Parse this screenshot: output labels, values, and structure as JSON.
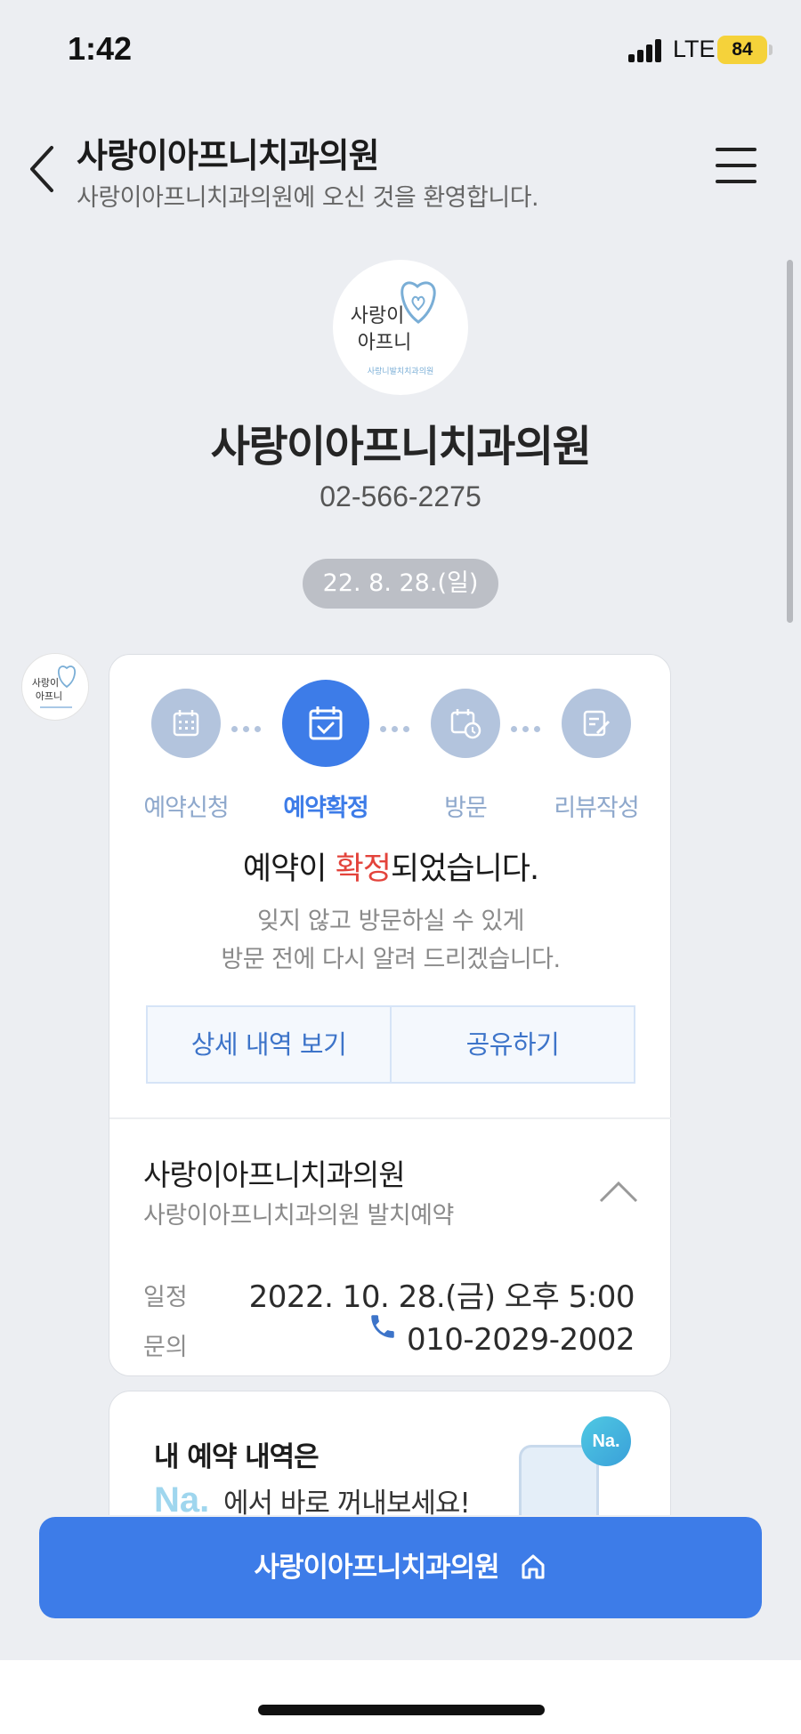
{
  "status_bar": {
    "time": "1:42",
    "network": "LTE",
    "battery": "84"
  },
  "header": {
    "title": "사랑이아프니치과의원",
    "subtitle": "사랑이아프니치과의원에 오신 것을 환영합니다."
  },
  "profile": {
    "logo_line1": "사랑이",
    "logo_line2": "아프니",
    "logo_caption": "사랑니발치치과의원",
    "name": "사랑이아프니치과의원",
    "phone": "02-566-2275"
  },
  "chat": {
    "date": "22. 8. 28.(일)"
  },
  "reservation": {
    "steps": [
      {
        "label": "예약신청",
        "icon": "calendar-icon",
        "active": false
      },
      {
        "label": "예약확정",
        "icon": "calendar-check-icon",
        "active": true
      },
      {
        "label": "방문",
        "icon": "calendar-clock-icon",
        "active": false
      },
      {
        "label": "리뷰작성",
        "icon": "review-edit-icon",
        "active": false
      }
    ],
    "title_prefix": "예약이 ",
    "title_highlight": "확정",
    "title_suffix": "되었습니다.",
    "desc_line1": "잊지 않고 방문하실 수 있게",
    "desc_line2": "방문 전에 다시 알려 드리겠습니다.",
    "detail_button": "상세 내역 보기",
    "share_button": "공유하기",
    "clinic_name": "사랑이아프니치과의원",
    "service": "사랑이아프니치과의원 발치예약",
    "schedule_label": "일정",
    "schedule_value": "2022. 10. 28.(금) 오후 5:00",
    "contact_label": "문의",
    "contact_value": "010-2029-2002"
  },
  "promo": {
    "line1": "내 예약 내역은",
    "na": "Na.",
    "line2": "에서 바로 꺼내보세요!",
    "badge": "Na."
  },
  "cta": {
    "label": "사랑이아프니치과의원"
  },
  "colors": {
    "accent": "#3d7ce8",
    "highlight": "#e3433b",
    "step_inactive": "#b3c4dd"
  }
}
